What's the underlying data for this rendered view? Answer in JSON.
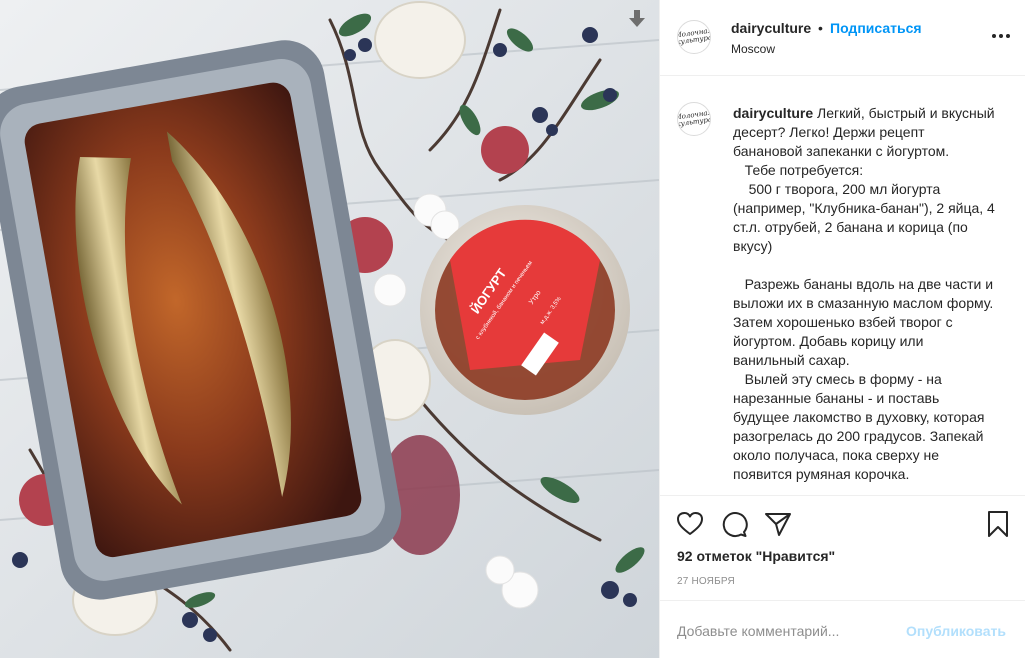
{
  "post": {
    "username": "dairyculture",
    "separator": "•",
    "follow_label": "Подписаться",
    "location": "Moscow",
    "avatar_logo": "Молочная культура",
    "caption_text": "Легкий, быстрый и вкусный десерт? Легко! Держи рецепт банановой запеканки с йогуртом.\n   Тебе потребуется:\n    500 г творога, 200 мл йогурта (например, \"Клубника-банан\"), 2 яйца, 4 ст.л. отрубей, 2 банана и корица (по вкусу)\n\n   Разрежь бананы вдоль на две части и выложи их в смазанную маслом форму. Затем хорошенько взбей творог с йогуртом. Добавь корицу или ванильный сахар.\n   Вылей эту смесь в форму - на нарезанные бананы - и поставь будущее лакомство в духовку, которая разогрелась до 200 градусов. Запекай около получаса, пока сверху не появится румяная корочка.",
    "likes_text": "92 отметок \"Нравится\"",
    "date": "27 ноября"
  },
  "photo": {
    "jar_label_title": "ЙОГУРТ",
    "jar_label_sub": "с клубникой, бананом и печеньем",
    "jar_label_brand": "Утро",
    "jar_label_fat": "м.д.ж. 3,5%"
  },
  "comment_box": {
    "placeholder": "Добавьте комментарий...",
    "publish_label": "Опубликовать"
  },
  "icons": [
    "download-icon",
    "more-options-icon",
    "heart-icon",
    "comment-icon",
    "share-icon",
    "bookmark-icon"
  ],
  "colors": {
    "link_blue": "#0095f6",
    "publish_disabled": "#b2dffc",
    "border": "#efefef",
    "text": "#262626",
    "muted": "#8e8e8e"
  }
}
